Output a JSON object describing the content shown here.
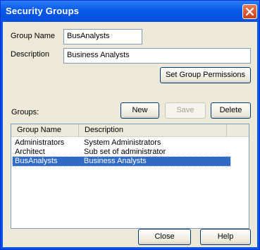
{
  "window": {
    "title": "Security Groups"
  },
  "form": {
    "group_name_label": "Group Name",
    "group_name_value": "BusAnalysts",
    "description_label": "Description",
    "description_value": "Business Analysts",
    "set_permissions_label": "Set Group Permissions",
    "groups_label": "Groups:"
  },
  "toolbar": {
    "new_label": "New",
    "save_label": "Save",
    "delete_label": "Delete"
  },
  "table": {
    "columns": [
      "Group Name",
      "Description"
    ],
    "rows": [
      {
        "name": "Administrators",
        "description": "System Administrators"
      },
      {
        "name": "Architect",
        "description": "Sub set of administrator"
      },
      {
        "name": "BusAnalysts",
        "description": "Business Analysts",
        "selected": true
      }
    ]
  },
  "footer": {
    "close_label": "Close",
    "help_label": "Help"
  },
  "colors": {
    "titlebar": "#0a54e3",
    "selection": "#316ac5",
    "dialog_bg": "#ece9d8"
  },
  "icons": {
    "close": "close-icon"
  }
}
